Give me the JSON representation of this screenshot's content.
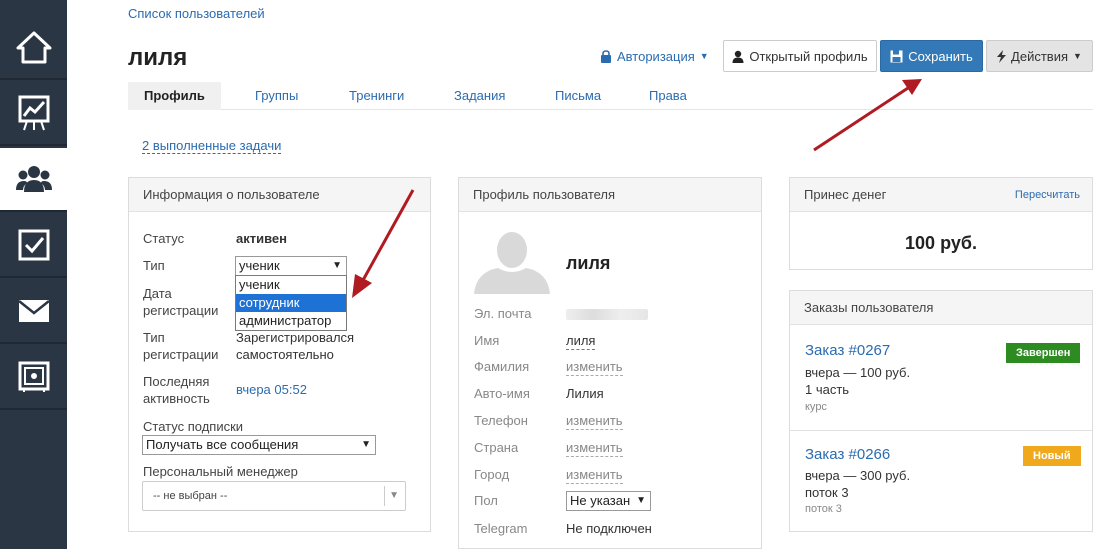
{
  "breadcrumb": "Список пользователей",
  "title": "лиля",
  "actions": {
    "auth": "Авторизация",
    "open_profile": "Открытый профиль",
    "save": "Сохранить",
    "more": "Действия"
  },
  "tabs": [
    "Профиль",
    "Группы",
    "Тренинги",
    "Задания",
    "Письма",
    "Права"
  ],
  "tasks_link": "2 выполненные задачи",
  "user_info": {
    "title": "Информация о пользователе",
    "status_label": "Статус",
    "status_value": "активен",
    "type_label": "Тип",
    "type_selected": "ученик",
    "type_options": [
      "ученик",
      "сотрудник",
      "администратор"
    ],
    "reg_date_label": "Дата регистрации",
    "reg_date_label_1": "Дата",
    "reg_date_label_2": "регистрации",
    "reg_type_label_1": "Тип",
    "reg_type_label_2": "регистрации",
    "reg_type_value_1": "Зарегистрировался",
    "reg_type_value_2": "самостоятельно",
    "last_active_label_1": "Последняя",
    "last_active_label_2": "активность",
    "last_active_value": "вчера 05:52",
    "subscription_label": "Статус подписки",
    "subscription_value": "Получать все сообщения",
    "manager_label": "Персональный менеджер",
    "manager_value": "-- не выбран --"
  },
  "profile": {
    "title": "Профиль пользователя",
    "name": "лиля",
    "email_label": "Эл. почта",
    "first_name_label": "Имя",
    "first_name_value": "лиля",
    "last_name_label": "Фамилия",
    "edit": "изменить",
    "auto_name_label": "Авто-имя",
    "auto_name_value": "Лилия",
    "phone_label": "Телефон",
    "country_label": "Страна",
    "city_label": "Город",
    "gender_label": "Пол",
    "gender_value": "Не указан",
    "telegram_label": "Telegram",
    "telegram_value": "Не подключен"
  },
  "money": {
    "title": "Принес денег",
    "recalc": "Пересчитать",
    "amount": "100 руб."
  },
  "orders": {
    "title": "Заказы пользователя",
    "items": [
      {
        "number": "Заказ #0267",
        "status": "Завершен",
        "status_color": "#2e8b22",
        "when": "вчера — 100 руб.",
        "detail": "1 часть",
        "type": "курс"
      },
      {
        "number": "Заказ #0266",
        "status": "Новый",
        "status_color": "#f0a91c",
        "when": "вчера — 300 руб.",
        "detail": "поток 3",
        "type": "поток 3"
      }
    ]
  },
  "colors": {
    "sidebar": "#2b3644",
    "primary": "#3479b7",
    "link": "#2b6cb0",
    "arrow": "#b01b22"
  }
}
